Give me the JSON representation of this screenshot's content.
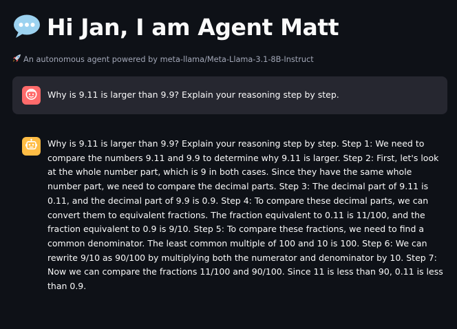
{
  "header": {
    "title_icon": "speech-balloon-icon",
    "title": "Hi Jan, I am Agent Matt",
    "subtitle_icon": "rocket-icon",
    "subtitle": "An autonomous agent powered by meta-llama/Meta-Llama-3.1-8B-Instruct"
  },
  "chat": {
    "user_message": {
      "avatar_icon": "user-face-icon",
      "avatar_color": "#ff6b6b",
      "text": "Why is 9.11 is larger than 9.9? Explain your reasoning step by step."
    },
    "assistant_message": {
      "avatar_icon": "robot-icon",
      "avatar_color": "#ffbd45",
      "text": "Why is 9.11 is larger than 9.9? Explain your reasoning step by step.  Step 1: We need to compare the numbers 9.11 and 9.9 to determine why 9.11 is larger. Step 2: First, let's look at the whole number part, which is 9 in both cases. Since they have the same whole number part, we need to compare the decimal parts. Step 3: The decimal part of 9.11 is 0.11, and the decimal part of 9.9 is 0.9. Step 4: To compare these decimal parts, we can convert them to equivalent fractions. The fraction equivalent to 0.11 is 11/100, and the fraction equivalent to 0.9 is 9/10. Step 5: To compare these fractions, we need to find a common denominator. The least common multiple of 100 and 10 is 100. Step 6: We can rewrite 9/10 as 90/100 by multiplying both the numerator and denominator by 10. Step 7: Now we can compare the fractions 11/100 and 90/100. Since 11 is less than 90, 0.11 is less than 0.9."
    }
  },
  "theme": {
    "background": "#0e1117",
    "user_bubble": "#262730",
    "text": "#fafafa",
    "muted_text": "#a3a8b8"
  }
}
